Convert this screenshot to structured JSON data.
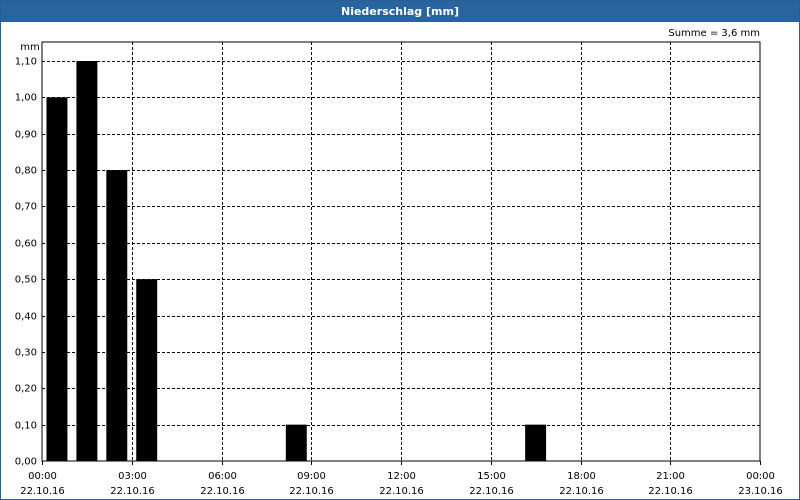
{
  "window": {
    "title": "Niederschlag [mm]"
  },
  "chart_data": {
    "type": "bar",
    "title": "Niederschlag [mm]",
    "ylabel": "mm",
    "summary": "Summe = 3,6 mm",
    "ylim": [
      0,
      1.1
    ],
    "xlim": [
      0,
      24
    ],
    "y_ticks": [
      "0,00",
      "0,10",
      "0,20",
      "0,30",
      "0,40",
      "0,50",
      "0,60",
      "0,70",
      "0,80",
      "0,90",
      "1,00",
      "1,10"
    ],
    "x_ticks": [
      {
        "time": "00:00",
        "date": "22.10.16"
      },
      {
        "time": "03:00",
        "date": "22.10.16"
      },
      {
        "time": "06:00",
        "date": "22.10.16"
      },
      {
        "time": "09:00",
        "date": "22.10.16"
      },
      {
        "time": "12:00",
        "date": "22.10.16"
      },
      {
        "time": "15:00",
        "date": "22.10.16"
      },
      {
        "time": "18:00",
        "date": "22.10.16"
      },
      {
        "time": "21:00",
        "date": "22.10.16"
      },
      {
        "time": "00:00",
        "date": "23.10.16"
      }
    ],
    "bar_color": "#000000",
    "grid": true,
    "bars": [
      {
        "hour": 0,
        "value": 1.0
      },
      {
        "hour": 1,
        "value": 1.1
      },
      {
        "hour": 2,
        "value": 0.8
      },
      {
        "hour": 3,
        "value": 0.5
      },
      {
        "hour": 8,
        "value": 0.1
      },
      {
        "hour": 16,
        "value": 0.1
      }
    ]
  }
}
